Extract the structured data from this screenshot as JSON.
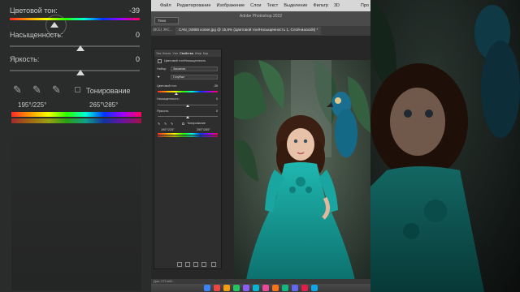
{
  "left_panel": {
    "hue_label": "Цветовой тон:",
    "hue_value": "-39",
    "saturation_label": "Насыщенность:",
    "saturation_value": "0",
    "lightness_label": "Яркость:",
    "lightness_value": "0",
    "colorize_label": "Тонирование",
    "range_left": "195°/225°",
    "range_right": "265°\\285°"
  },
  "menubar": {
    "items": [
      "Файл",
      "Редактирование",
      "Изображение",
      "Слои",
      "Текст",
      "Выделение",
      "Фильтр",
      "3D",
      "Про"
    ]
  },
  "options": {
    "tool_box": "Тени",
    "mode_box": "(ВСЕ) ЭКС..."
  },
  "app_title": "Adobe Photoshop 2022",
  "document": {
    "tab_title": "CAN_04865 копия.jpg @ 15,6% (Цветовой тон/Насыщенность 1, Слой-маска/8) *",
    "zoom": "15,6%",
    "status": "Док: 273 мб/..."
  },
  "properties": {
    "tabs": [
      "Эск",
      "Кисти",
      "Уал",
      "Свойства",
      "Инф",
      "Кор"
    ],
    "active_tab": "Свойства",
    "layer_name": "Цветовой тон/Насыщенность",
    "preset_label": "Набор:",
    "preset_value": "Заказная",
    "channel_value": "Голубые",
    "hue_label": "Цветовой тон:",
    "hue_value": "-39",
    "saturation_label": "Насыщенность:",
    "saturation_value": "0",
    "lightness_label": "Яркость:",
    "lightness_value": "0",
    "colorize_label": "Тонирование",
    "range_left": "195°/225°",
    "range_right": "265°\\285°"
  },
  "colors": {
    "menubar_bg": "#d7d7d7",
    "panel_bg": "#2e2e2e",
    "dress": "#149e9a",
    "background_leaves": "#2f5a3c"
  },
  "dock_colors": [
    "#3a83f5",
    "#ef4444",
    "#f59e0b",
    "#22c55e",
    "#8b5cf6",
    "#06b6d4",
    "#ec4899",
    "#f97316",
    "#10b981",
    "#6366f1",
    "#e11d48",
    "#0ea5e9"
  ]
}
